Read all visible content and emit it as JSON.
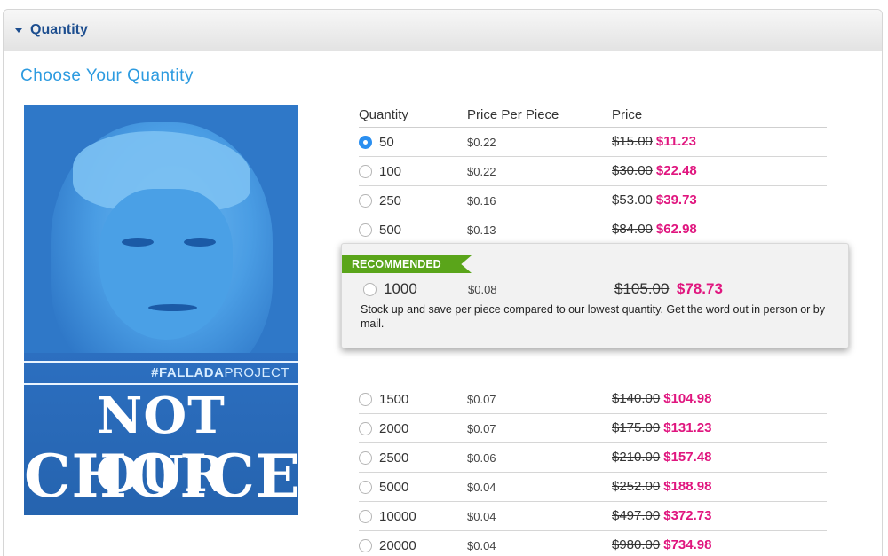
{
  "panel": {
    "title": "Quantity"
  },
  "section_title": "Choose Your Quantity",
  "poster": {
    "hashtag_bold": "#FALLADA",
    "hashtag_rest": "PROJECT",
    "line1": "NOT OUR",
    "line2": "CHOICE"
  },
  "table": {
    "headers": {
      "quantity": "Quantity",
      "price_per_piece": "Price Per Piece",
      "price": "Price"
    },
    "rows_top": [
      {
        "qty": "50",
        "ppp": "$0.22",
        "old": "$15.00",
        "new": "$11.23",
        "selected": true
      },
      {
        "qty": "100",
        "ppp": "$0.22",
        "old": "$30.00",
        "new": "$22.48",
        "selected": false
      },
      {
        "qty": "250",
        "ppp": "$0.16",
        "old": "$53.00",
        "new": "$39.73",
        "selected": false
      },
      {
        "qty": "500",
        "ppp": "$0.13",
        "old": "$84.00",
        "new": "$62.98",
        "selected": false
      }
    ],
    "recommended": {
      "badge": "RECOMMENDED",
      "qty": "1000",
      "ppp": "$0.08",
      "old": "$105.00",
      "new": "$78.73",
      "description": "Stock up and save per piece compared to our lowest quantity. Get the word out in person or by mail."
    },
    "rows_bottom": [
      {
        "qty": "1500",
        "ppp": "$0.07",
        "old": "$140.00",
        "new": "$104.98",
        "selected": false
      },
      {
        "qty": "2000",
        "ppp": "$0.07",
        "old": "$175.00",
        "new": "$131.23",
        "selected": false
      },
      {
        "qty": "2500",
        "ppp": "$0.06",
        "old": "$210.00",
        "new": "$157.48",
        "selected": false
      },
      {
        "qty": "5000",
        "ppp": "$0.04",
        "old": "$252.00",
        "new": "$188.98",
        "selected": false
      },
      {
        "qty": "10000",
        "ppp": "$0.04",
        "old": "$497.00",
        "new": "$372.73",
        "selected": false
      },
      {
        "qty": "20000",
        "ppp": "$0.04",
        "old": "$980.00",
        "new": "$734.98",
        "selected": false
      }
    ]
  },
  "colors": {
    "accent_blue": "#2d9be0",
    "header_blue": "#1d4e8f",
    "sale_pink": "#e0167f",
    "badge_green": "#5aa51a"
  }
}
